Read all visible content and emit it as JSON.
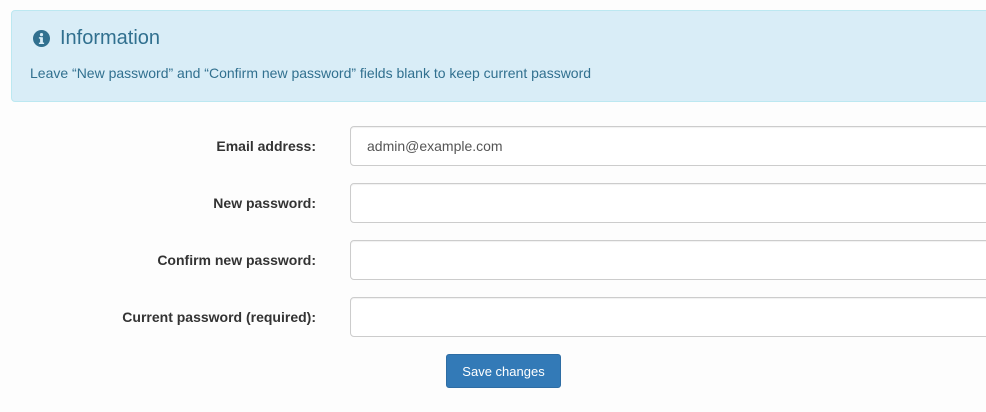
{
  "info_panel": {
    "icon": "info-circle-icon",
    "title": "Information",
    "message": "Leave “New password” and “Confirm new password” fields blank to keep current password"
  },
  "form": {
    "email": {
      "label": "Email address:",
      "value": "admin@example.com",
      "placeholder": ""
    },
    "new_password": {
      "label": "New password:",
      "value": "",
      "placeholder": ""
    },
    "confirm_password": {
      "label": "Confirm new password:",
      "value": "",
      "placeholder": ""
    },
    "current_password": {
      "label": "Current password (required):",
      "value": "",
      "placeholder": ""
    },
    "save_label": "Save changes"
  },
  "colors": {
    "info_background": "#d9edf7",
    "info_text": "#31708f",
    "primary_button": "#337ab7"
  }
}
